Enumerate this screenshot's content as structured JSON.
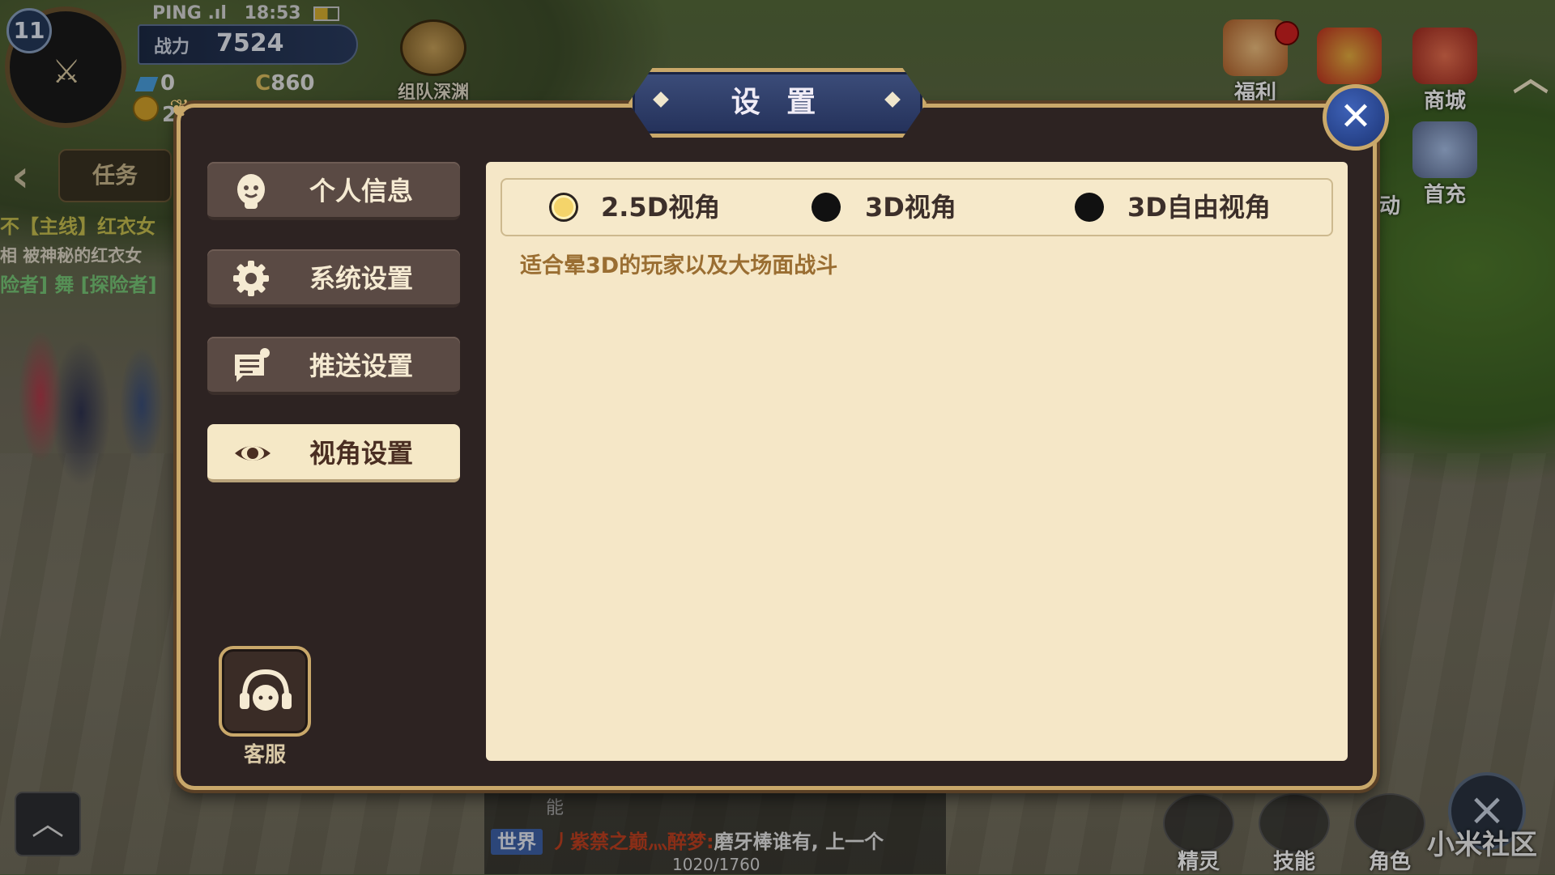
{
  "hud": {
    "level": "11",
    "ping_label": "PING",
    "time": "18:53",
    "power_label": "战力",
    "power_value": "7524",
    "gem_value": "0",
    "currency_value": "860",
    "coin_value": "2",
    "team_label": "组队深渊",
    "quest_tab": "任务",
    "quest_lines": [
      "不【主线】红衣女",
      "相 被神秘的红衣女",
      "险者] 舞 [探险者]"
    ],
    "top_icons": [
      {
        "label": "福利",
        "icon": "cake-icon"
      },
      {
        "label": "",
        "icon": "gift-icon"
      },
      {
        "label": "商城",
        "icon": "shop-icon"
      }
    ],
    "side_labels": [
      {
        "label": "动"
      },
      {
        "label": "首充"
      }
    ],
    "bottom_icons": [
      {
        "label": "精灵",
        "icon": "sprite-icon"
      },
      {
        "label": "技能",
        "icon": "skill-icon"
      },
      {
        "label": "角色",
        "icon": "character-icon"
      }
    ],
    "chat": {
      "cut_text": "能",
      "channel": "世界",
      "sender": "丿紫禁之巅灬醉梦:",
      "message": "磨牙棒谁有, 上一个",
      "exp": "1020/1760"
    },
    "watermark": "小米社区"
  },
  "dialog": {
    "title": "设 置",
    "close_glyph": "✕",
    "nav": [
      {
        "label": "个人信息",
        "icon": "face-icon",
        "active": false
      },
      {
        "label": "系统设置",
        "icon": "gear-icon",
        "active": false
      },
      {
        "label": "推送设置",
        "icon": "message-icon",
        "active": false
      },
      {
        "label": "视角设置",
        "icon": "eye-icon",
        "active": true
      }
    ],
    "service_label": "客服",
    "view_options": [
      {
        "label": "2.5D视角",
        "selected": true
      },
      {
        "label": "3D视角",
        "selected": false
      },
      {
        "label": "3D自由视角",
        "selected": false
      }
    ],
    "description": "适合晕3D的玩家以及大场面战斗"
  }
}
